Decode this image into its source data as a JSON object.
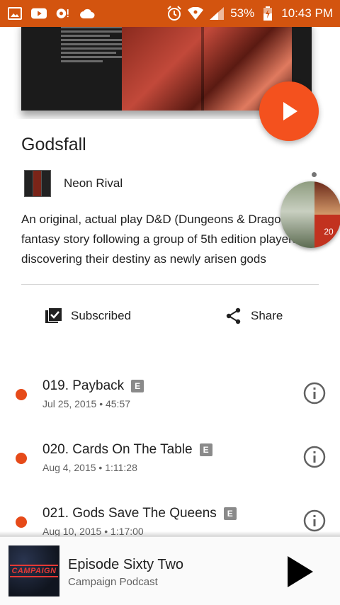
{
  "status_bar": {
    "battery_percent": "53%",
    "time": "10:43 PM",
    "icons_left": [
      "image-icon",
      "youtube-icon",
      "podcast-notification-icon",
      "cloud-icon"
    ],
    "icons_right": [
      "alarm-icon",
      "wifi-icon",
      "cell-signal-icon",
      "battery-charging-icon"
    ]
  },
  "podcast": {
    "title": "Godsfall",
    "author": "Neon Rival",
    "description_lines": [
      "An original, actual play D&D (Dungeons & Dragons)",
      "fantasy story following a group of 5th edition players",
      "discovering their destiny as newly arisen gods"
    ]
  },
  "chat_head": {
    "dice_label": "20"
  },
  "actions": {
    "subscribed_label": "Subscribed",
    "share_label": "Share"
  },
  "episodes": [
    {
      "title": "019. Payback",
      "badge": "E",
      "date": "Jul 25, 2015",
      "duration": "45:57"
    },
    {
      "title": "020. Cards On The Table",
      "badge": "E",
      "date": "Aug 4, 2015",
      "duration": "1:11:28"
    },
    {
      "title": "021. Gods Save The Queens",
      "badge": "E",
      "date": "Aug 10, 2015",
      "duration": "1:17:00"
    }
  ],
  "meta_separator": "•",
  "now_playing": {
    "episode_title": "Episode Sixty Two",
    "podcast_name": "Campaign Podcast",
    "art_text": "CAMPAIGN"
  },
  "colors": {
    "status_bar": "#d3540f",
    "accent": "#f4511e",
    "unplayed_dot": "#e64a19"
  }
}
